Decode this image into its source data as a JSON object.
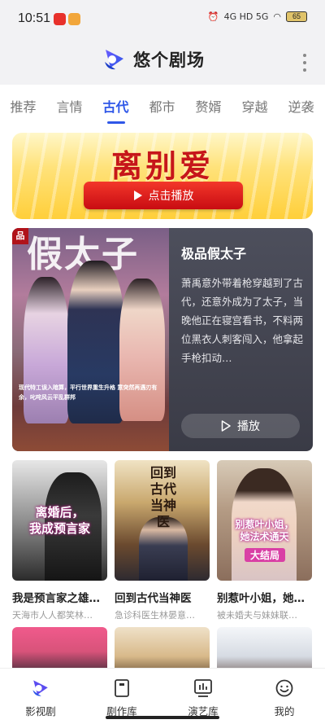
{
  "status_bar": {
    "time": "10:51",
    "net": "4G HD 5G",
    "battery": "65"
  },
  "header": {
    "app_name": "悠个剧场"
  },
  "tabs": [
    {
      "label": "推荐"
    },
    {
      "label": "言情"
    },
    {
      "label": "古代",
      "active": true
    },
    {
      "label": "都市"
    },
    {
      "label": "赘婿"
    },
    {
      "label": "穿越"
    },
    {
      "label": "逆袭"
    }
  ],
  "banner": {
    "title": "离别爱",
    "button": "点击播放"
  },
  "feature": {
    "poster_tag": "品",
    "poster_title": "假太子",
    "poster_caption": "现代特工误入暗算，平行世界重生升格 意突然再遇刃有余，叱咤风云平乱群邦",
    "title": "极品假太子",
    "description": "萧禹意外带着枪穿越到了古代，还意外成为了太子，当晚他正在寝宫看书，不料两位黑衣人刺客闯入，他拿起手枪扣动…",
    "play": "播放"
  },
  "dramas": [
    {
      "title": "我是预言家之雄…",
      "subtitle": "天海市人人都笑林…",
      "poster_text": "离婚后，\n我成预言家"
    },
    {
      "title": "回到古代当神医",
      "subtitle": "急诊科医生林晏意…",
      "poster_text": "回到古代当神医"
    },
    {
      "title": "别惹叶小姐，她…",
      "subtitle": "被未婚夫与妹妹联…",
      "poster_text": "别惹叶小姐，\n她法术通天",
      "badge": "大结局"
    }
  ],
  "nav": [
    {
      "label": "影视剧",
      "icon": "play-logo-icon"
    },
    {
      "label": "剧作库",
      "icon": "book-icon"
    },
    {
      "label": "演艺库",
      "icon": "chart-icon"
    },
    {
      "label": "我的",
      "icon": "smile-icon"
    }
  ]
}
